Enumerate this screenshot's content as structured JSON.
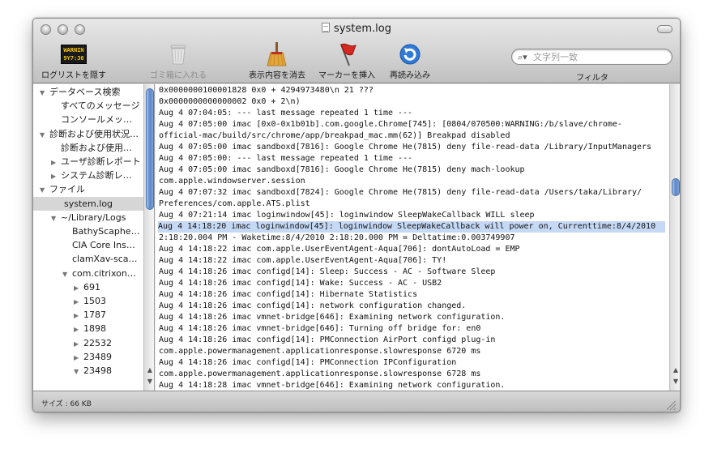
{
  "window": {
    "title": "system.log"
  },
  "toolbar": {
    "hide_log_list": {
      "label": "ログリストを隠す",
      "icon": "warning-console-icon",
      "icon_text": [
        "WARNIN",
        "9Y7:36"
      ]
    },
    "trash": {
      "label": "ゴミ箱に入れる",
      "icon": "trash-icon"
    },
    "clear_display": {
      "label": "表示内容を消去",
      "icon": "broom-icon"
    },
    "insert_marker": {
      "label": "マーカーを挿入",
      "icon": "flag-icon"
    },
    "reload": {
      "label": "再読み込み",
      "icon": "reload-icon"
    },
    "search": {
      "placeholder": "文字列一致",
      "value": ""
    },
    "filter_label": "フィルタ"
  },
  "sidebar": {
    "items": [
      {
        "label": "データベース検索",
        "level": 0,
        "expander": "open"
      },
      {
        "label": "すべてのメッセージ",
        "level": 1,
        "expander": "none"
      },
      {
        "label": "コンソールメッ…",
        "level": 1,
        "expander": "none"
      },
      {
        "label": "診断および使用状況…",
        "level": 0,
        "expander": "open"
      },
      {
        "label": "診断および使用…",
        "level": 1,
        "expander": "none"
      },
      {
        "label": "ユーザ診断レポート",
        "level": 1,
        "expander": "closed"
      },
      {
        "label": "システム診断レ…",
        "level": 1,
        "expander": "closed"
      },
      {
        "label": "ファイル",
        "level": 0,
        "expander": "open"
      },
      {
        "label": "system.log",
        "level": 1,
        "expander": "none",
        "selected": true
      },
      {
        "label": "~/Library/Logs",
        "level": 1,
        "expander": "open"
      },
      {
        "label": "BathyScaphe…",
        "level": 2,
        "expander": "none"
      },
      {
        "label": "CIA Core Ins…",
        "level": 2,
        "expander": "none"
      },
      {
        "label": "clamXav-sca…",
        "level": 2,
        "expander": "none"
      },
      {
        "label": "com.citrixon…",
        "level": 2,
        "expander": "open"
      },
      {
        "label": "691",
        "level": 3,
        "expander": "closed"
      },
      {
        "label": "1503",
        "level": 3,
        "expander": "closed"
      },
      {
        "label": "1787",
        "level": 3,
        "expander": "closed"
      },
      {
        "label": "1898",
        "level": 3,
        "expander": "closed"
      },
      {
        "label": "22532",
        "level": 3,
        "expander": "closed"
      },
      {
        "label": "23489",
        "level": 3,
        "expander": "closed"
      },
      {
        "label": "23498",
        "level": 3,
        "expander": "open"
      }
    ]
  },
  "log": {
    "lines": [
      "0x0000000100001828 0x0 + 4294973480\\n          21  ???",
      "0x0000000000000002 0x0 + 2\\n)",
      "Aug  4 07:04:05: --- last message repeated 1 time ---",
      "Aug  4 07:05:00 imac [0x0-0x1b01b].com.google.Chrome[745]: [0804/070500:WARNING:/b/slave/chrome-",
      "official-mac/build/src/chrome/app/breakpad_mac.mm(62)] Breakpad disabled",
      "Aug  4 07:05:00 imac sandboxd[7816]: Google Chrome He(7815) deny file-read-data /Library/InputManagers",
      "Aug  4 07:05:00: --- last message repeated 1 time ---",
      "Aug  4 07:05:00 imac sandboxd[7816]: Google Chrome He(7815) deny mach-lookup",
      "com.apple.windowserver.session",
      "Aug  4 07:07:32 imac sandboxd[7824]: Google Chrome He(7815) deny file-read-data /Users/taka/Library/",
      "Preferences/com.apple.ATS.plist",
      "Aug  4 07:21:14 imac loginwindow[45]: loginwindow SleepWakeCallback WILL sleep",
      "Aug  4 14:18:20 imac loginwindow[45]: loginwindow SleepWakeCallback will power on, Currenttime:8/4/2010",
      "2:18:20.004 PM - Waketime:8/4/2010 2:18:20.000 PM = Deltatime:0.003749907",
      "Aug  4 14:18:22 imac com.apple.UserEventAgent-Aqua[706]: dontAutoLoad = EMP",
      "Aug  4 14:18:22 imac com.apple.UserEventAgent-Aqua[706]: TY!",
      "Aug  4 14:18:26 imac configd[14]: Sleep: Success - AC - Software Sleep",
      "Aug  4 14:18:26 imac configd[14]: Wake: Success - AC - USB2",
      "Aug  4 14:18:26 imac configd[14]: Hibernate Statistics",
      "Aug  4 14:18:26 imac configd[14]: network configuration changed.",
      "Aug  4 14:18:26 imac vmnet-bridge[646]: Examining network configuration.",
      "Aug  4 14:18:26 imac vmnet-bridge[646]: Turning off bridge for: en0",
      "Aug  4 14:18:26 imac configd[14]: PMConnection AirPort configd plug-in",
      "com.apple.powermanagement.applicationresponse.slowresponse 6720 ms",
      "Aug  4 14:18:26 imac configd[14]: PMConnection IPConfiguration",
      "com.apple.powermanagement.applicationresponse.slowresponse 6728 ms",
      "Aug  4 14:18:28 imac vmnet-bridge[646]: Examining network configuration."
    ],
    "highlighted_lines": [
      12
    ]
  },
  "status": {
    "size": "サイズ : 66 KB"
  },
  "colors": {
    "selection": "#c5d9f5",
    "sidebar_selection": "#d6d6d6",
    "scroll_thumb": "#5a86c7",
    "warning_text": "#f4c400"
  }
}
